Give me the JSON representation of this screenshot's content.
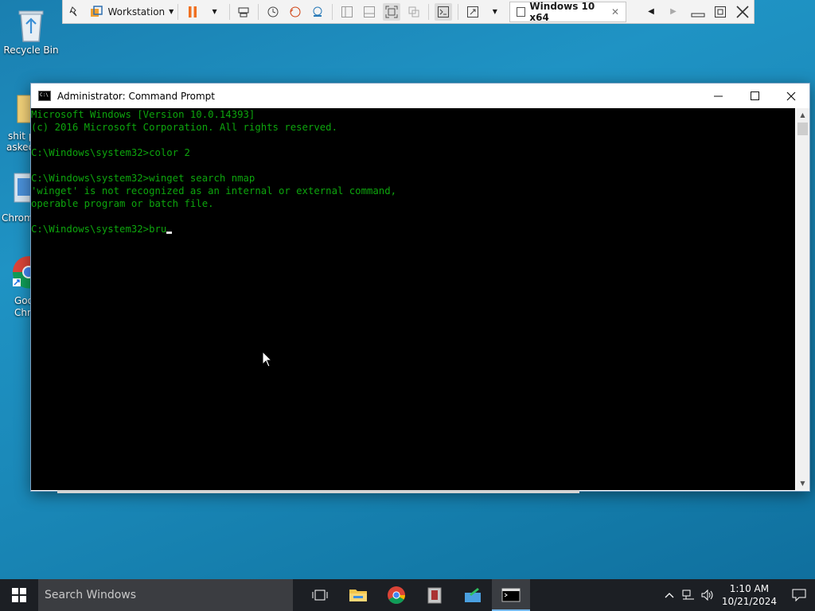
{
  "desktop": {
    "icons": [
      {
        "label": "Recycle Bin"
      }
    ],
    "clipped_labels": [
      "shit p",
      "asked",
      "Chrom",
      "Goo",
      "Chro"
    ]
  },
  "vm_toolbar": {
    "library_label": "Workstation",
    "tab_label": "Windows 10 x64",
    "tab_close": "✕"
  },
  "cmd": {
    "title": "Administrator: Command Prompt",
    "lines": [
      "Microsoft Windows [Version 10.0.14393]",
      "(c) 2016 Microsoft Corporation. All rights reserved.",
      "",
      "C:\\Windows\\system32>color 2",
      "",
      "C:\\Windows\\system32>winget search nmap",
      "'winget' is not recognized as an internal or external command,",
      "operable program or batch file.",
      "",
      "C:\\Windows\\system32>bru"
    ],
    "text_color": "#0da50d"
  },
  "taskbar": {
    "search_placeholder": "Search Windows",
    "time": "1:10 AM",
    "date": "10/21/2024",
    "apps": [
      "task-view",
      "file-explorer",
      "chrome",
      "archive-app",
      "paint-app",
      "command-prompt"
    ]
  }
}
